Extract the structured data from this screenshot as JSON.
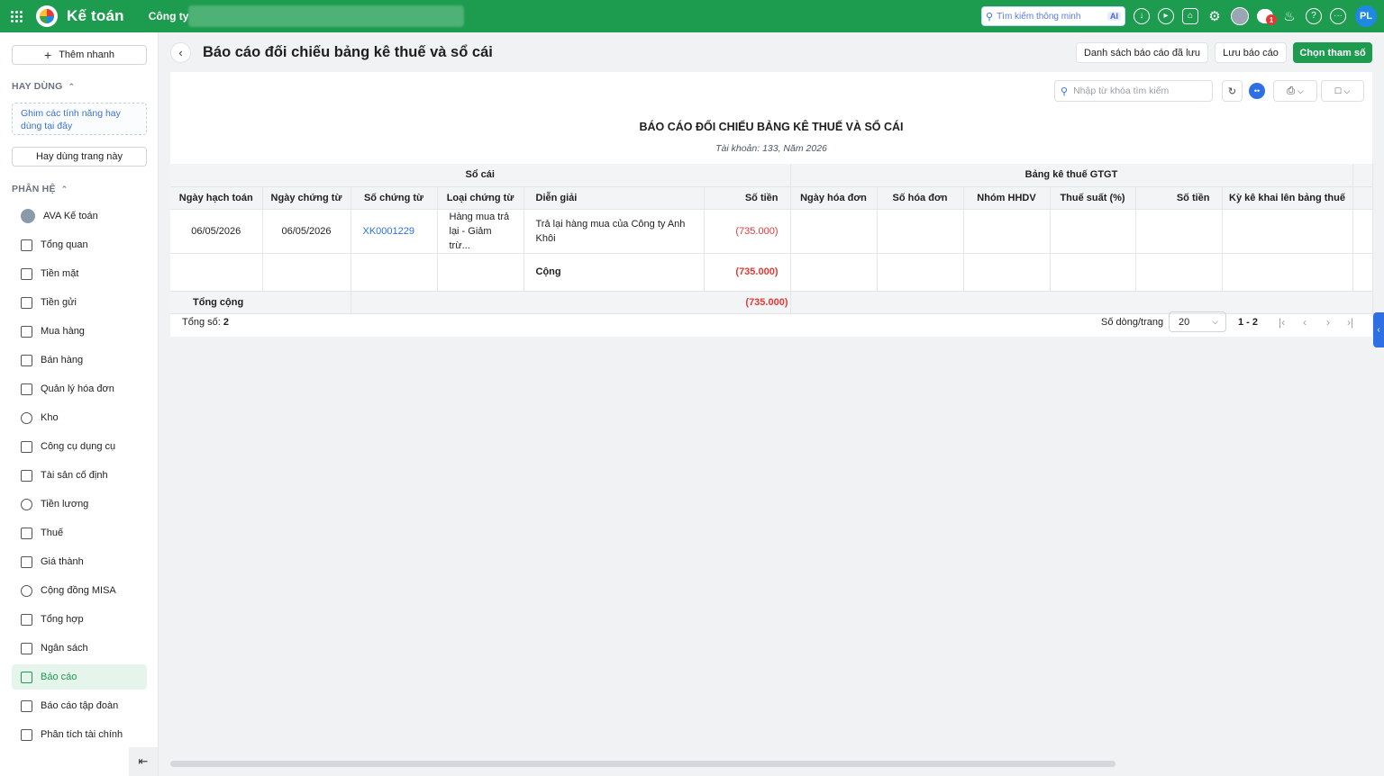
{
  "topbar": {
    "app_name": "Kế toán",
    "company_label": "Công ty",
    "smart_search_placeholder": "Tìm kiếm thông minh",
    "ai_badge": "AI",
    "notification_count": "1",
    "user_initials": "PL",
    "brand_color": "#1d9b4f"
  },
  "sidebar": {
    "quick_add_label": "Thêm nhanh",
    "frequent_section": "HAY DÙNG",
    "pin_hint": "Ghim các tính năng hay dùng tại đây",
    "frequent_page_button": "Hay dùng trang này",
    "modules_section": "PHÂN HỆ",
    "items": [
      {
        "label": "AVA Kế toán",
        "icon": "ava-avatar-icon"
      },
      {
        "label": "Tổng quan",
        "icon": "dashboard-icon"
      },
      {
        "label": "Tiền mặt",
        "icon": "cash-icon"
      },
      {
        "label": "Tiền gửi",
        "icon": "bank-icon"
      },
      {
        "label": "Mua hàng",
        "icon": "shopping-bag-icon"
      },
      {
        "label": "Bán hàng",
        "icon": "cart-icon"
      },
      {
        "label": "Quản lý hóa đơn",
        "icon": "invoice-icon"
      },
      {
        "label": "Kho",
        "icon": "warehouse-icon"
      },
      {
        "label": "Công cụ dụng cụ",
        "icon": "tools-icon"
      },
      {
        "label": "Tài sản cố định",
        "icon": "asset-icon"
      },
      {
        "label": "Tiền lương",
        "icon": "salary-icon"
      },
      {
        "label": "Thuế",
        "icon": "tax-icon"
      },
      {
        "label": "Giá thành",
        "icon": "price-tag-icon"
      },
      {
        "label": "Cộng đồng MISA",
        "icon": "community-icon"
      },
      {
        "label": "Tổng hợp",
        "icon": "summary-icon"
      },
      {
        "label": "Ngân sách",
        "icon": "budget-icon"
      },
      {
        "label": "Báo cáo",
        "icon": "report-chart-icon",
        "active": true
      },
      {
        "label": "Báo cáo tập đoàn",
        "icon": "group-report-icon"
      },
      {
        "label": "Phân tích tài chính",
        "icon": "analytics-icon"
      }
    ]
  },
  "header": {
    "title": "Báo cáo đối chiếu bảng kê thuế và sổ cái",
    "saved_reports_button": "Danh sách báo cáo đã lưu",
    "save_report_button": "Lưu báo cáo",
    "choose_params_button": "Chọn tham số"
  },
  "report": {
    "search_placeholder": "Nhập từ khóa tìm kiếm",
    "title": "BÁO CÁO ĐỐI CHIẾU BẢNG KÊ THUẾ VÀ SỔ CÁI",
    "subtitle": "Tài khoản: 133, Năm 2026",
    "group_ledger": "Sổ cái",
    "group_vat": "Bảng kê thuế GTGT",
    "columns": [
      "Ngày hạch toán",
      "Ngày chứng từ",
      "Số chứng từ",
      "Loại chứng từ",
      "Diễn giải",
      "Số tiền",
      "Ngày hóa đơn",
      "Số hóa đơn",
      "Nhóm HHDV",
      "Thuế suất (%)",
      "Số tiền",
      "Kỳ kê khai lên bảng thuế"
    ],
    "row": {
      "posting_date": "06/05/2026",
      "voucher_date": "06/05/2026",
      "voucher_no": "XK0001229",
      "voucher_type": "Hàng mua trả lại - Giảm trừ...",
      "description": "Trả lại hàng mua của Công ty Anh Khôi",
      "amount": "(735.000)"
    },
    "subtotal_label": "Cộng",
    "subtotal_amount": "(735.000)",
    "grand_total_label": "Tổng cộng",
    "grand_total_amount": "(735.000)",
    "footer": {
      "total_label": "Tổng số:",
      "total_value": "2",
      "rows_per_page_label": "Số dòng/trang",
      "rows_per_page_value": "20",
      "range": "1 - 2"
    }
  }
}
